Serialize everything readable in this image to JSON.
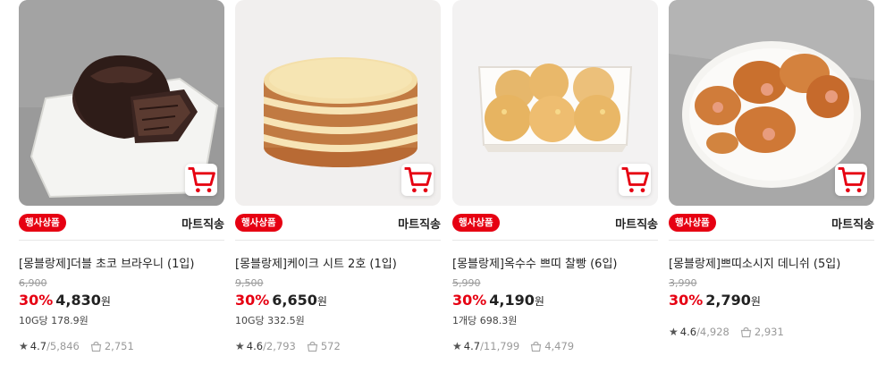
{
  "colors": {
    "accent": "#e60012",
    "badge_text": "#ffffff"
  },
  "products": [
    {
      "badge": "행사상품",
      "delivery": "마트직송",
      "name": "[몽블랑제]더블 초코 브라우니 (1입)",
      "original_price": "6,900",
      "discount": "30%",
      "price": "4,830",
      "currency": "원",
      "unit_price": "10G당 178.9원",
      "rating": "4.7",
      "reviews": "/5,846",
      "purchases": "2,751",
      "image": "chocolate-brownie-on-plate"
    },
    {
      "badge": "행사상품",
      "delivery": "마트직송",
      "name": "[몽블랑제]케이크 시트 2호 (1입)",
      "original_price": "9,500",
      "discount": "30%",
      "price": "6,650",
      "currency": "원",
      "unit_price": "10G당 332.5원",
      "rating": "4.6",
      "reviews": "/2,793",
      "purchases": "572",
      "image": "sponge-cake-layers"
    },
    {
      "badge": "행사상품",
      "delivery": "마트직송",
      "name": "[몽블랑제]옥수수 쁘띠 찰빵 (6입)",
      "original_price": "5,990",
      "discount": "30%",
      "price": "4,190",
      "currency": "원",
      "unit_price": "1개당 698.3원",
      "rating": "4.7",
      "reviews": "/11,799",
      "purchases": "4,479",
      "image": "corn-bread-tray"
    },
    {
      "badge": "행사상품",
      "delivery": "마트직송",
      "name": "[몽블랑제]쁘띠소시지 데니쉬 (5입)",
      "original_price": "3,990",
      "discount": "30%",
      "price": "2,790",
      "currency": "원",
      "unit_price": "",
      "rating": "4.6",
      "reviews": "/4,928",
      "purchases": "2,931",
      "image": "sausage-danish-plate"
    }
  ]
}
